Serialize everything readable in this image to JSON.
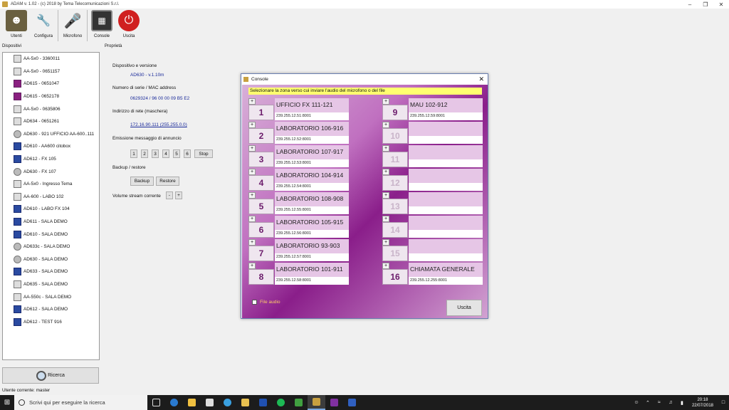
{
  "window": {
    "title": "ADAM v. 1.02 - (c) 2018 by Tema Telecomunicazioni S.r.l.",
    "controls": [
      "–",
      "❐",
      "✕"
    ]
  },
  "toolbar": {
    "items": [
      {
        "label": "Utenti",
        "icon": "users-icon",
        "color": "#5a5a40"
      },
      {
        "label": "Configura",
        "icon": "wrench-icon",
        "color": "#7a7a7a"
      },
      {
        "label": "Microfono",
        "icon": "microphone-icon",
        "color": "#3a6aa0"
      },
      {
        "label": "Console",
        "icon": "console-icon",
        "color": "#3a3a3a"
      },
      {
        "label": "Uscita",
        "icon": "power-icon",
        "color": "#c02020"
      }
    ]
  },
  "sidebar": {
    "header": "Dispositivi",
    "devices": [
      {
        "label": "AA-5x0 - 3360011",
        "icon": "gray"
      },
      {
        "label": "AA-5x0 - 0651157",
        "icon": "gray"
      },
      {
        "label": "AD615 - 0651047",
        "icon": "purple"
      },
      {
        "label": "AD615 - 0652178",
        "icon": "purple"
      },
      {
        "label": "AA-5x0 - 0635806",
        "icon": "gray"
      },
      {
        "label": "AD634 - 0651261",
        "icon": "gray"
      },
      {
        "label": "AD630 - 921 UFFICIO AA-600..111",
        "icon": "round"
      },
      {
        "label": "AD610 - AA600 citobox",
        "icon": "blue"
      },
      {
        "label": "AD612 - FX 105",
        "icon": "blue"
      },
      {
        "label": "AD630 - FX 107",
        "icon": "round"
      },
      {
        "label": "AA-5x0 - Ingresso Tema",
        "icon": "gray"
      },
      {
        "label": "AA-600 - LABO 102",
        "icon": "gray"
      },
      {
        "label": "AD610 - LABO FX 104",
        "icon": "blue"
      },
      {
        "label": "AD611 - SALA DEMO",
        "icon": "blue"
      },
      {
        "label": "AD610 - SALA DEMO",
        "icon": "blue"
      },
      {
        "label": "AD633c - SALA DEMO",
        "icon": "round"
      },
      {
        "label": "AD630 - SALA DEMO",
        "icon": "round"
      },
      {
        "label": "AD633 - SALA DEMO",
        "icon": "blue"
      },
      {
        "label": "AD635 - SALA DEMO",
        "icon": "gray"
      },
      {
        "label": "AA-550c - SALA DEMO",
        "icon": "gray"
      },
      {
        "label": "AD612 - SALA DEMO",
        "icon": "blue"
      },
      {
        "label": "AD612 - TEST 916",
        "icon": "blue"
      }
    ],
    "search_label": "Ricerca"
  },
  "properties": {
    "header": "Proprietà",
    "device_version_label": "Dispositivo e versione",
    "device_version_value": "AD630 - v.1.10m",
    "serial_label": "Numero di serie / MAC address",
    "serial_value": "0629324 / 96 00 00 09 B5 E2",
    "network_label": "Indirizzo di rete (maschera)",
    "network_value": "172.16.90.111 (255.255.0.0)",
    "announce_label": "Emissione messaggio di annuncio",
    "announce_buttons": [
      "1",
      "2",
      "3",
      "4",
      "5",
      "6"
    ],
    "stop_label": "Stop",
    "backup_label": "Backup / restore",
    "backup_button": "Backup",
    "restore_button": "Restore",
    "volume_label": "Volume stream corrente",
    "volume_minus": "-",
    "volume_plus": "+"
  },
  "console": {
    "title": "Console",
    "close": "✕",
    "banner": "Selezionare la zona verso cui inviare l'audio del microfono o del file",
    "zones": [
      {
        "num": "1",
        "name": "UFFICIO FX 111-121",
        "addr": "239.255.12.51:8001",
        "active": true
      },
      {
        "num": "2",
        "name": "LABORATORIO 106-916",
        "addr": "239.255.12.52:8001",
        "active": true
      },
      {
        "num": "3",
        "name": "LABORATORIO 107-917",
        "addr": "239.255.12.53:8001",
        "active": true
      },
      {
        "num": "4",
        "name": "LABORATORIO 104-914",
        "addr": "239.255.12.54:8001",
        "active": true
      },
      {
        "num": "5",
        "name": "LABORATORIO 108-908",
        "addr": "239.255.12.55:8001",
        "active": true
      },
      {
        "num": "6",
        "name": "LABORATORIO 105-915",
        "addr": "239.255.12.56:8001",
        "active": true
      },
      {
        "num": "7",
        "name": "LABORATORIO 93-903",
        "addr": "239.255.12.57:8001",
        "active": true
      },
      {
        "num": "8",
        "name": "LABORATORIO 101-911",
        "addr": "239.255.12.58:8001",
        "active": true
      },
      {
        "num": "9",
        "name": "MAU 102-912",
        "addr": "239.255.12.59:8001",
        "active": true
      },
      {
        "num": "10",
        "name": "",
        "addr": "",
        "active": false
      },
      {
        "num": "11",
        "name": "",
        "addr": "",
        "active": false
      },
      {
        "num": "12",
        "name": "",
        "addr": "",
        "active": false
      },
      {
        "num": "13",
        "name": "",
        "addr": "",
        "active": false
      },
      {
        "num": "14",
        "name": "",
        "addr": "",
        "active": false
      },
      {
        "num": "15",
        "name": "",
        "addr": "",
        "active": false
      },
      {
        "num": "16",
        "name": "CHIAMATA GENERALE",
        "addr": "239.255.12.255:8001",
        "active": true
      }
    ],
    "plus_label": "+",
    "file_audio_label": "File audio",
    "file_audio_checked": false,
    "exit_label": "Uscita"
  },
  "status_bar": {
    "text": "Utente corrente: master"
  },
  "taskbar": {
    "search_placeholder": "Scrivi qui per eseguire la ricerca",
    "time": "20:18",
    "date": "22/07/2018"
  }
}
